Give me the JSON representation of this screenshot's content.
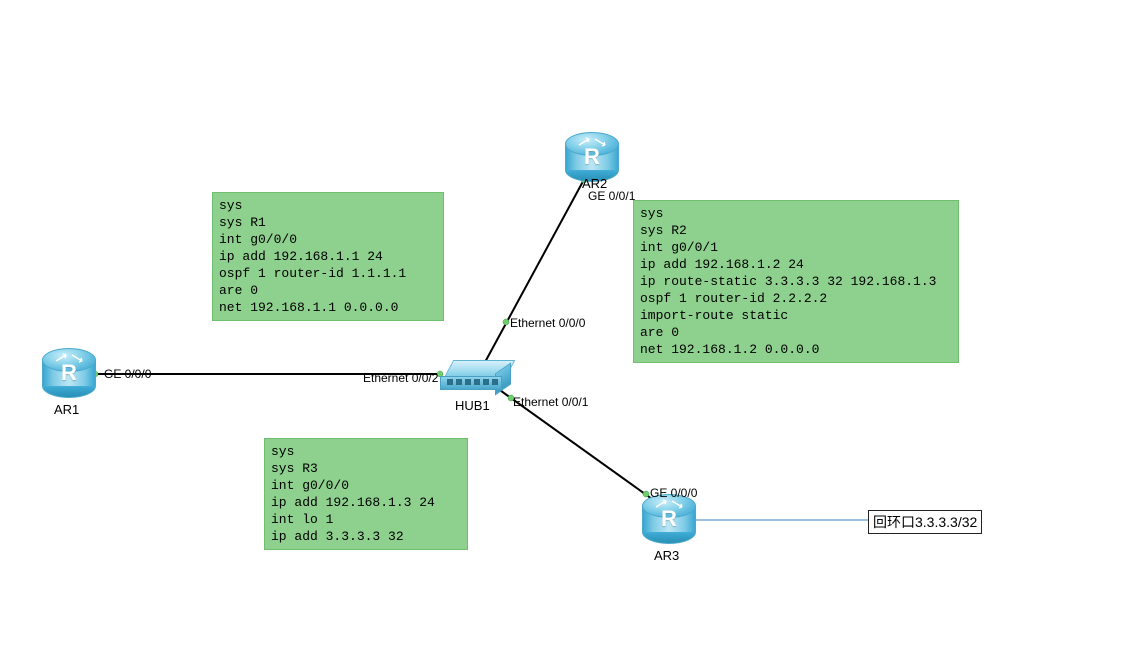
{
  "devices": {
    "ar1": {
      "label": "AR1"
    },
    "ar2": {
      "label": "AR2"
    },
    "ar3": {
      "label": "AR3"
    },
    "hub1": {
      "label": "HUB1"
    }
  },
  "ports": {
    "ar1_ge000": "GE 0/0/0",
    "ar2_ge001": "GE 0/0/1",
    "ar3_ge000": "GE 0/0/0",
    "hub_e000": "Ethernet 0/0/0",
    "hub_e001": "Ethernet 0/0/1",
    "hub_e002": "Ethernet 0/0/2"
  },
  "config": {
    "r1": "sys\nsys R1\nint g0/0/0\nip add 192.168.1.1 24\nospf 1 router-id 1.1.1.1\nare 0\nnet 192.168.1.1 0.0.0.0",
    "r2": "sys\nsys R2\nint g0/0/1\nip add 192.168.1.2 24\nip route-static 3.3.3.3 32 192.168.1.3\nospf 1 router-id 2.2.2.2\nimport-route static\nare 0\nnet 192.168.1.2 0.0.0.0",
    "r3": "sys\nsys R3\nint g0/0/0\nip add 192.168.1.3 24\nint lo 1\nip add 3.3.3.3 32"
  },
  "loopback": {
    "label": "回环口3.3.3.3/32"
  }
}
